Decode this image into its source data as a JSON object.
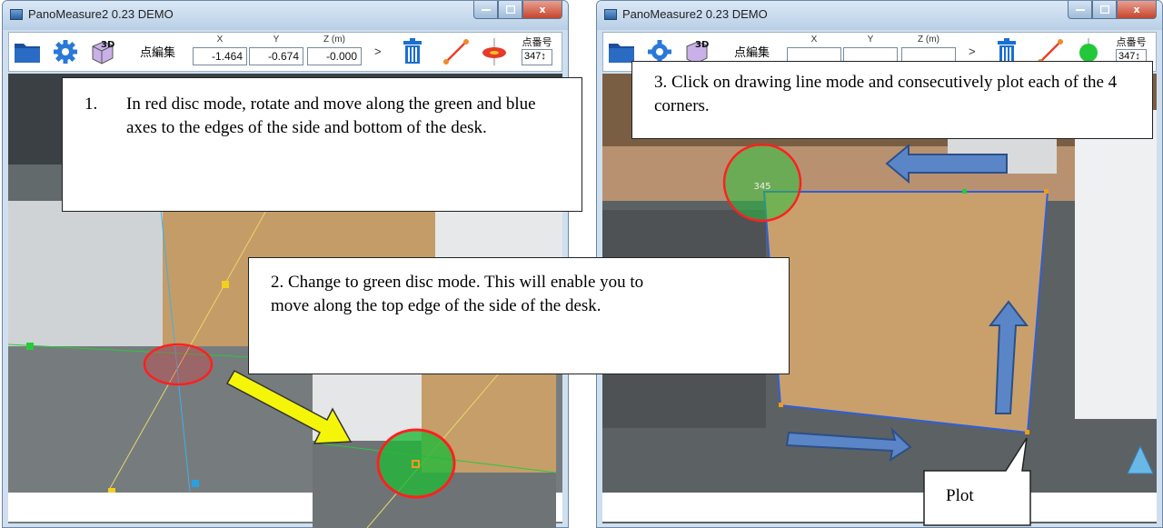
{
  "window": {
    "title": "PanoMeasure2 0.23 DEMO",
    "close_glyph": "x"
  },
  "toolbar": {
    "edit_label": "点編集",
    "x_label": "X",
    "y_label": "Y",
    "z_label": "Z (m)",
    "x_value": "-1.464",
    "y_value": "-0.674",
    "z_value": "-0.000",
    "next_glyph": ">",
    "point_number_label": "点番号",
    "point_number_value": "347",
    "icons": [
      "folder-icon",
      "gear-icon",
      "3d-box-icon",
      "trash-icon",
      "line-draw-icon",
      "red-disc-icon"
    ]
  },
  "right_toolbar": {
    "icons": [
      "folder-icon",
      "gear-icon",
      "3d-box-icon",
      "trash-icon",
      "line-draw-icon",
      "green-disc-icon"
    ]
  },
  "scene": {
    "point_label": "345"
  },
  "callouts": {
    "step1_number": "1.",
    "step1_text": "In red disc mode, rotate and move along the green and blue axes to the edges of the side and bottom of the desk.",
    "step2_text": "2. Change to green disc mode. This will enable you to move along the top edge of the side of the desk.",
    "step3_text": "3. Click on drawing line mode and consecutively plot each of the 4 corners.",
    "plot_label": "Plot"
  },
  "colors": {
    "accent_yellow": "#f5f50a",
    "red_disc": "#e02020",
    "green_disc": "#22b83a",
    "blue_arrow": "#5a86c8"
  }
}
